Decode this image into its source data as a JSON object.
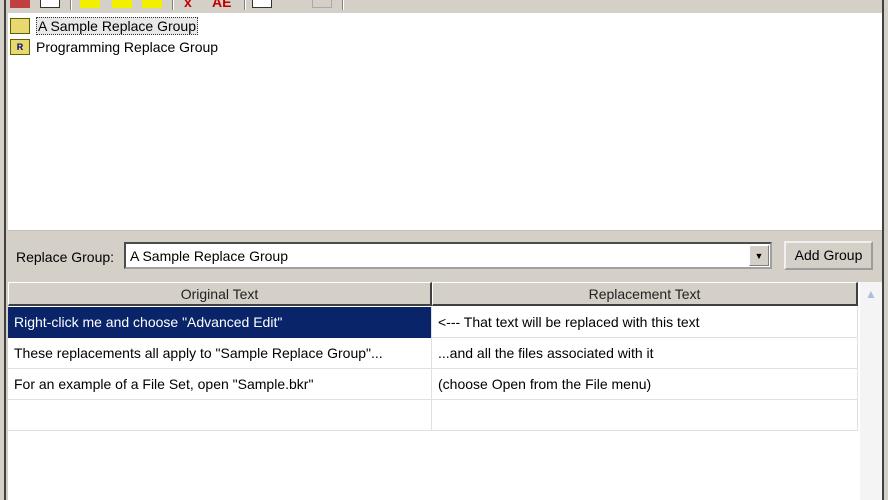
{
  "toolbar": {
    "icons": [
      "print-icon",
      "new-icon",
      "group-icon-1",
      "group-icon-2",
      "group-icon-3",
      "delete-icon",
      "replace-all-icon",
      "edit-icon",
      "check-icon",
      "list-icon",
      "find-icon"
    ]
  },
  "tree": {
    "items": [
      {
        "label": "A Sample Replace Group",
        "selected": true,
        "icon": "open-folder-icon",
        "badge": ""
      },
      {
        "label": "Programming Replace Group",
        "selected": false,
        "icon": "folder-icon",
        "badge": "R"
      }
    ]
  },
  "group": {
    "label": "Replace Group:",
    "value": "A Sample Replace Group",
    "add_button": "Add Group"
  },
  "grid": {
    "columns": [
      "Original Text",
      "Replacement Text"
    ],
    "rows": [
      {
        "original": "Right-click me and choose \"Advanced Edit\"",
        "replacement": "<--- That text will be replaced with this text",
        "selected": true
      },
      {
        "original": "These replacements all apply to \"Sample Replace Group\"...",
        "replacement": "...and all the files associated with it",
        "selected": false
      },
      {
        "original": "For an example of a File Set, open \"Sample.bkr\"",
        "replacement": "(choose Open from the File menu)",
        "selected": false
      },
      {
        "original": "",
        "replacement": "",
        "selected": false
      }
    ]
  },
  "colors": {
    "selection": "#0a246a"
  }
}
